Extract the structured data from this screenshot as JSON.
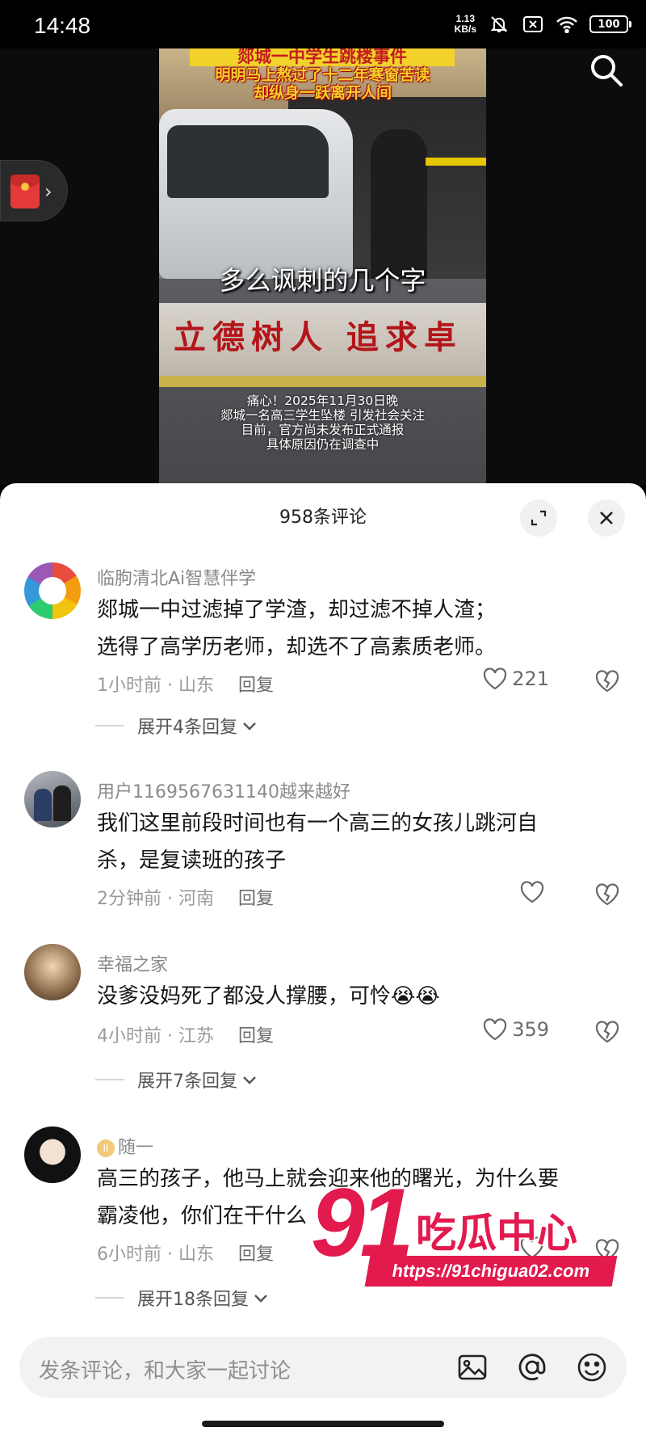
{
  "status_bar": {
    "time": "14:48",
    "net_speed_value": "1.13",
    "net_speed_unit": "KB/s",
    "battery": "100",
    "icons": [
      "mute-bell-icon",
      "sim-off-icon",
      "wifi-icon",
      "battery-icon"
    ]
  },
  "video": {
    "title_banner": "郯城一中学生跳楼事件",
    "subtitle_line1": "明明马上熬过了十二年寒窗苦读",
    "subtitle_line2": "却纵身一跃离开人间",
    "caption": "多么讽刺的几个字",
    "wall_text": "立德树人  追求卓",
    "notice_lines": [
      "痛心！2025年11月30日晚",
      "郯城一名高三学生坠楼 引发社会关注",
      "目前，官方尚未发布正式通报",
      "具体原因仍在调查中"
    ]
  },
  "comments_sheet": {
    "title": "958条评论",
    "comments": [
      {
        "user": "临朐清北Ai智慧伴学",
        "text_lines": [
          "郯城一中过滤掉了学渣，却过滤不掉人渣；",
          "选得了高学历老师，却选不了高素质老师。"
        ],
        "time": "1小时前",
        "location": "山东",
        "reply_label": "回复",
        "likes": "221",
        "expand_label": "展开4条回复"
      },
      {
        "user": "用户1169567631140越来越好",
        "text_lines": [
          "我们这里前段时间也有一个高三的女孩儿跳河自",
          "杀，是复读班的孩子"
        ],
        "time": "2分钟前",
        "location": "河南",
        "reply_label": "回复",
        "likes": ""
      },
      {
        "user": "幸福之家",
        "text_lines": [
          "没爹没妈死了都没人撑腰，可怜😭😭"
        ],
        "time": "4小时前",
        "location": "江苏",
        "reply_label": "回复",
        "likes": "359",
        "expand_label": "展开7条回复"
      },
      {
        "user": "随一",
        "badge": "II",
        "text_lines": [
          "高三的孩子，他马上就会迎来他的曙光，为什么要",
          "霸凌他，你们在干什么"
        ],
        "time": "6小时前",
        "location": "山东",
        "reply_label": "回复",
        "likes": "",
        "expand_label": "展开18条回复"
      }
    ]
  },
  "input_bar": {
    "placeholder": "发条评论，和大家一起讨论",
    "icons": [
      "image-icon",
      "at-icon",
      "emoji-icon"
    ]
  },
  "watermark": {
    "number": "91",
    "text": "吃瓜中心",
    "url": "https://91chigua02.com"
  },
  "colors": {
    "accent_red": "#e21a4d",
    "banner_yellow": "#f3d22b"
  }
}
